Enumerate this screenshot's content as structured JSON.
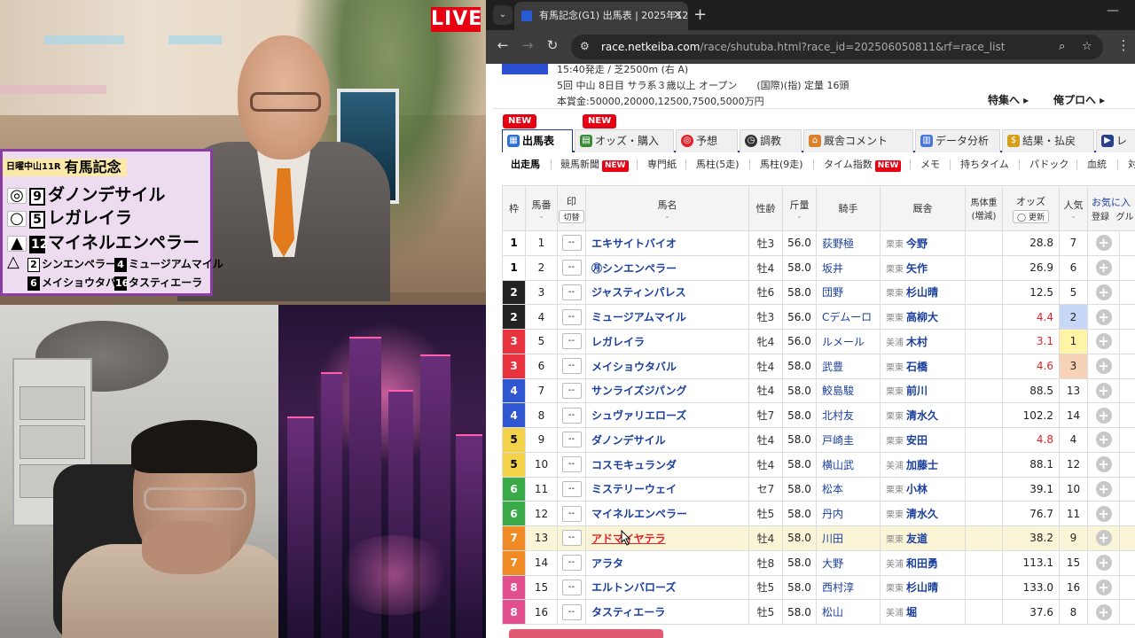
{
  "broadcast": {
    "live_label": "LIVE",
    "card": {
      "header_small": "日曜中山11R",
      "header_big": "有馬記念",
      "picks": [
        {
          "mark": "◎",
          "num": "9",
          "name": "ダノンデサイル",
          "inverse": false
        },
        {
          "mark": "○",
          "num": "5",
          "name": "レガレイラ",
          "inverse": false
        },
        {
          "mark": "▲",
          "num": "12",
          "name": "マイネルエンペラー",
          "inverse": true
        }
      ],
      "others_mark": "△",
      "others": [
        {
          "num": "2",
          "name": "シンエンペラー",
          "inverse": false
        },
        {
          "num": "4",
          "name": "ミュージアムマイル",
          "inverse": true
        },
        {
          "num": "6",
          "name": "メイショウタバル",
          "inverse": true
        },
        {
          "num": "16",
          "name": "タスティエーラ",
          "inverse": true
        }
      ]
    }
  },
  "browser": {
    "tab_title": "有馬記念(G1) 出馬表 | 2025年12",
    "url_host": "race.netkeiba.com",
    "url_path": "/race/shutuba.html?race_id=202506050811&rf=race_list"
  },
  "race": {
    "line1": "15:40発走 / 芝2500m (右 A)",
    "line2": "5回 中山 8日目 サラ系３歳以上 オープン　　(国際)(指) 定量 16頭",
    "line3": "本賞金:50000,20000,12500,7500,5000万円",
    "special1": "特集へ ▸",
    "special2": "俺プロへ ▸"
  },
  "main_tabs": [
    "出馬表",
    "オッズ・購入",
    "予想",
    "調教",
    "厩舎コメント",
    "データ分析",
    "結果・払戻",
    "レ"
  ],
  "new_badge": "NEW",
  "sub_tabs": [
    "出走馬",
    "競馬新聞",
    "専門紙",
    "馬柱(5走)",
    "馬柱(9走)",
    "タイム指数",
    "メモ",
    "持ちタイム",
    "パドック",
    "血統",
    "対"
  ],
  "headers": {
    "waku": "枠",
    "umaban": "馬番",
    "mark": "印",
    "mark_switch": "切替",
    "name": "馬名",
    "sexage": "性齢",
    "weight": "斤量",
    "jockey": "騎手",
    "stable": "厩舎",
    "bodyweight": "馬体重(増減)",
    "odds": "オッズ",
    "refresh": "◯ 更新",
    "pop": "人気",
    "fav": "お気に入",
    "fav_reg": "登録",
    "fav_grp": "グル"
  },
  "mark_placeholder": "--",
  "fav_plus": "+",
  "horses": [
    {
      "waku": "1",
      "num": "1",
      "name": "エキサイトバイオ",
      "sex": "牡3",
      "wt": "56.0",
      "jockey": "荻野極",
      "area": "栗東",
      "trainer": "今野",
      "odds": "28.8",
      "pop": "7"
    },
    {
      "waku": "1",
      "num": "2",
      "name": "㊊シンエンペラー",
      "sex": "牡4",
      "wt": "58.0",
      "jockey": "坂井",
      "area": "栗東",
      "trainer": "矢作",
      "odds": "26.9",
      "pop": "6"
    },
    {
      "waku": "2",
      "num": "3",
      "name": "ジャスティンパレス",
      "sex": "牡6",
      "wt": "58.0",
      "jockey": "団野",
      "area": "栗東",
      "trainer": "杉山晴",
      "odds": "12.5",
      "pop": "5"
    },
    {
      "waku": "2",
      "num": "4",
      "name": "ミュージアムマイル",
      "sex": "牡3",
      "wt": "56.0",
      "jockey": "Cデムーロ",
      "area": "栗東",
      "trainer": "高柳大",
      "odds": "4.4",
      "pop": "2"
    },
    {
      "waku": "3",
      "num": "5",
      "name": "レガレイラ",
      "sex": "牝4",
      "wt": "56.0",
      "jockey": "ルメール",
      "area": "美浦",
      "trainer": "木村",
      "odds": "3.1",
      "pop": "1"
    },
    {
      "waku": "3",
      "num": "6",
      "name": "メイショウタバル",
      "sex": "牡4",
      "wt": "58.0",
      "jockey": "武豊",
      "area": "栗東",
      "trainer": "石橋",
      "odds": "4.6",
      "pop": "3"
    },
    {
      "waku": "4",
      "num": "7",
      "name": "サンライズジパング",
      "sex": "牡4",
      "wt": "58.0",
      "jockey": "鮫島駿",
      "area": "栗東",
      "trainer": "前川",
      "odds": "88.5",
      "pop": "13"
    },
    {
      "waku": "4",
      "num": "8",
      "name": "シュヴァリエローズ",
      "sex": "牡7",
      "wt": "58.0",
      "jockey": "北村友",
      "area": "栗東",
      "trainer": "清水久",
      "odds": "102.2",
      "pop": "14"
    },
    {
      "waku": "5",
      "num": "9",
      "name": "ダノンデサイル",
      "sex": "牡4",
      "wt": "58.0",
      "jockey": "戸崎圭",
      "area": "栗東",
      "trainer": "安田",
      "odds": "4.8",
      "pop": "4"
    },
    {
      "waku": "5",
      "num": "10",
      "name": "コスモキュランダ",
      "sex": "牡4",
      "wt": "58.0",
      "jockey": "横山武",
      "area": "美浦",
      "trainer": "加藤士",
      "odds": "88.1",
      "pop": "12"
    },
    {
      "waku": "6",
      "num": "11",
      "name": "ミステリーウェイ",
      "sex": "セ7",
      "wt": "58.0",
      "jockey": "松本",
      "area": "栗東",
      "trainer": "小林",
      "odds": "39.1",
      "pop": "10"
    },
    {
      "waku": "6",
      "num": "12",
      "name": "マイネルエンペラー",
      "sex": "牡5",
      "wt": "58.0",
      "jockey": "丹内",
      "area": "栗東",
      "trainer": "清水久",
      "odds": "76.7",
      "pop": "11"
    },
    {
      "waku": "7",
      "num": "13",
      "name": "アドマイヤテラ",
      "sex": "牡4",
      "wt": "58.0",
      "jockey": "川田",
      "area": "栗東",
      "trainer": "友道",
      "odds": "38.2",
      "pop": "9"
    },
    {
      "waku": "7",
      "num": "14",
      "name": "アラタ",
      "sex": "牡8",
      "wt": "58.0",
      "jockey": "大野",
      "area": "美浦",
      "trainer": "和田勇",
      "odds": "113.1",
      "pop": "15"
    },
    {
      "waku": "8",
      "num": "15",
      "name": "エルトンバローズ",
      "sex": "牡5",
      "wt": "58.0",
      "jockey": "西村淳",
      "area": "栗東",
      "trainer": "杉山晴",
      "odds": "133.0",
      "pop": "16"
    },
    {
      "waku": "8",
      "num": "16",
      "name": "タスティエーラ",
      "sex": "牡5",
      "wt": "58.0",
      "jockey": "松山",
      "area": "美浦",
      "trainer": "堀",
      "odds": "37.6",
      "pop": "8"
    }
  ],
  "hot_odds_horses": [
    "4",
    "5",
    "6",
    "9"
  ],
  "highlighted_horse": "13"
}
